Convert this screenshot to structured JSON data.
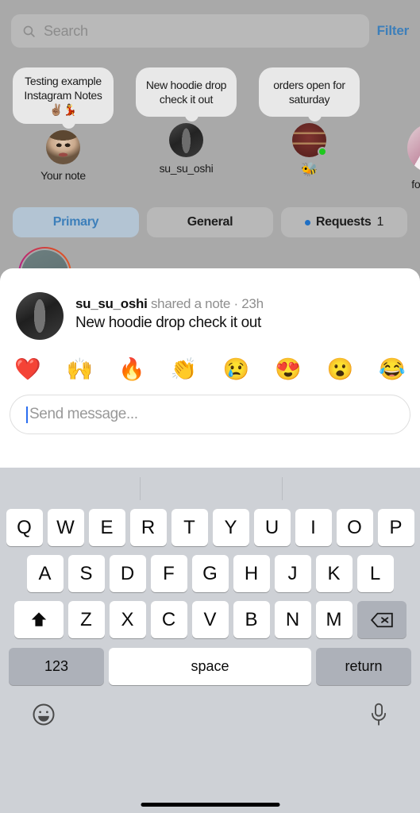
{
  "search": {
    "placeholder": "Search",
    "icon": "search-icon",
    "filter_label": "Filter",
    "filter_color": "#3d7fba"
  },
  "notes_tray": [
    {
      "bubble_text": "Testing example Instagram Notes ✌🏽💃",
      "username": "Your note",
      "avatar": "av-yournote",
      "online": false
    },
    {
      "bubble_text": "New hoodie drop check it out",
      "username": "su_su_oshi",
      "avatar": "av-susu",
      "online": false
    },
    {
      "bubble_text": "orders open for saturday",
      "username": "🐝",
      "avatar": "av-bee",
      "online": true
    },
    {
      "bubble_text": "",
      "username": "food_am",
      "avatar": "av-food",
      "online": false
    }
  ],
  "tabs": [
    {
      "label": "Primary",
      "active": true,
      "dot": false,
      "count": ""
    },
    {
      "label": "General",
      "active": false,
      "dot": false,
      "count": ""
    },
    {
      "label": "Requests",
      "active": false,
      "dot": true,
      "count": "1"
    }
  ],
  "note_sheet": {
    "username": "su_su_oshi",
    "meta_text": "shared a note · 23h",
    "note_text": "New hoodie drop check it out",
    "reactions": [
      "❤️",
      "🙌",
      "🔥",
      "👏",
      "😢",
      "😍",
      "😮",
      "😂"
    ],
    "input_placeholder": "Send message...",
    "caret_color": "#2b6ef0"
  },
  "keyboard": {
    "row1": [
      "Q",
      "W",
      "E",
      "R",
      "T",
      "Y",
      "U",
      "I",
      "O",
      "P"
    ],
    "row2": [
      "A",
      "S",
      "D",
      "F",
      "G",
      "H",
      "J",
      "K",
      "L"
    ],
    "row3": [
      "Z",
      "X",
      "C",
      "V",
      "B",
      "N",
      "M"
    ],
    "shift_icon": "shift-icon",
    "backspace_icon": "backspace-icon",
    "num_label": "123",
    "space_label": "space",
    "return_label": "return",
    "emoji_key_icon": "emoji-icon",
    "mic_key_icon": "microphone-icon"
  }
}
